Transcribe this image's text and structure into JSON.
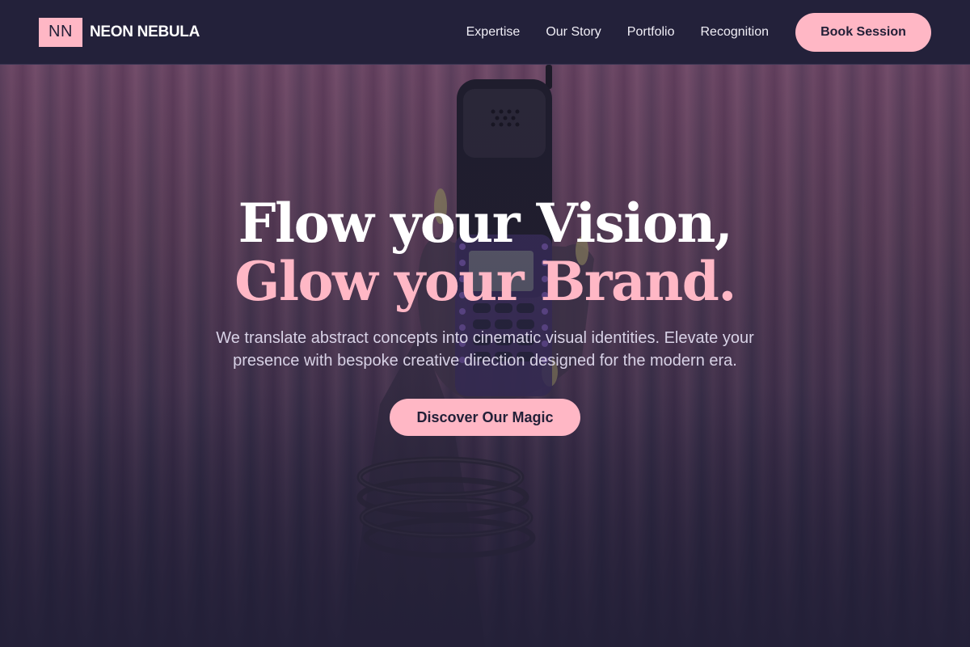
{
  "brand": {
    "mark": "NN",
    "name": "NEON NEBULA",
    "accent_color": "#ffb7c5",
    "background_color": "#232038"
  },
  "nav": {
    "links": [
      {
        "label": "Expertise"
      },
      {
        "label": "Our Story"
      },
      {
        "label": "Portfolio"
      },
      {
        "label": "Recognition"
      }
    ],
    "cta_label": "Book Session"
  },
  "hero": {
    "headline_line1": "Flow your Vision,",
    "headline_line2": "Glow your Brand.",
    "subtext": "We translate abstract concepts into cinematic visual identities. Elevate your presence with bespoke creative direction designed for the modern era.",
    "cta_label": "Discover Our Magic",
    "background_image": "hand-holding-retro-phone-illustration"
  }
}
